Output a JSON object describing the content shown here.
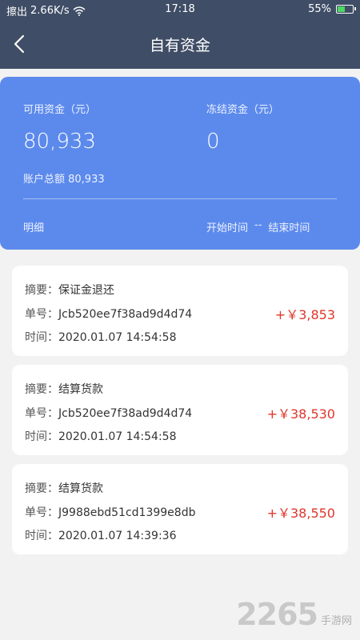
{
  "status_bar": {
    "carrier": "擦出",
    "network_speed": "2.66K/s",
    "time": "17:18",
    "battery_percent": "55%",
    "battery_level": 0.55
  },
  "nav": {
    "title": "自有资金"
  },
  "fund_card": {
    "available_label": "可用资金（元）",
    "available_value": "80,933",
    "frozen_label": "冻结资金（元）",
    "frozen_value": "0",
    "total_text": "账户总额 80,933",
    "detail_label": "明细",
    "start_time": "开始时间",
    "range_separator": "--",
    "end_time": "结束时间"
  },
  "transactions": [
    {
      "summary_key": "摘要：",
      "summary_value": "保证金退还",
      "order_key": "单号：",
      "order_value": "Jcb520ee7f38ad9d4d74",
      "time_key": "时间：",
      "time_value": "2020.01.07 14:54:58",
      "amount": "+￥3,853"
    },
    {
      "summary_key": "摘要：",
      "summary_value": "结算货款",
      "order_key": "单号：",
      "order_value": "Jcb520ee7f38ad9d4d74",
      "time_key": "时间：",
      "time_value": "2020.01.07 14:54:58",
      "amount": "+￥38,530"
    },
    {
      "summary_key": "摘要：",
      "summary_value": "结算货款",
      "order_key": "单号：",
      "order_value": "J9988ebd51cd1399e8db",
      "time_key": "时间：",
      "time_value": "2020.01.07 14:39:36",
      "amount": "+￥38,550"
    }
  ],
  "watermark": {
    "number": "2265",
    "text": "手游网"
  },
  "colors": {
    "header_bg": "#3f4d66",
    "card_bg": "#5c8aec",
    "amount_red": "#e0352b",
    "page_bg": "#f2f2f2"
  }
}
